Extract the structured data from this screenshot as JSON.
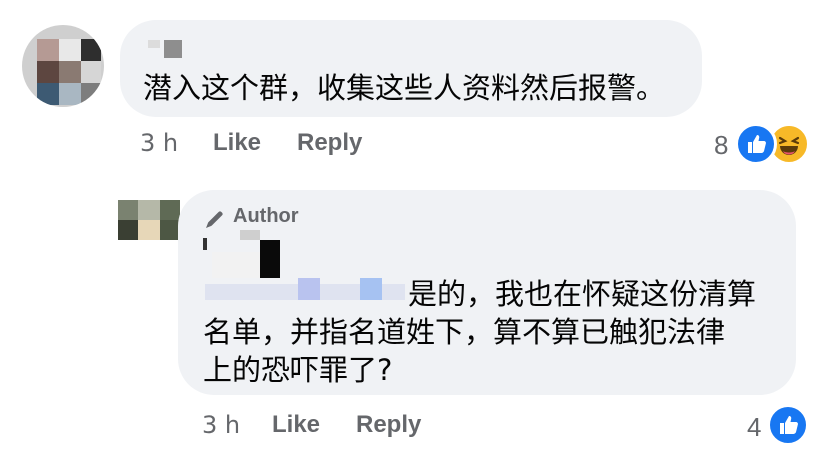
{
  "comment1": {
    "text": "潜入这个群，收集这些人资料然后报警。",
    "time": "3 h",
    "like_label": "Like",
    "reply_label": "Reply",
    "reaction_count": "8",
    "reactions": [
      "like-icon",
      "haha-icon"
    ]
  },
  "comment2": {
    "badge_label": "Author",
    "badge_icon": "pen-icon",
    "lines": [
      "是的，我也在怀疑这份清算",
      "名单，并指名道姓下，算不算已触犯法律",
      "上的恐吓罪了?"
    ],
    "time": "3 h",
    "like_label": "Like",
    "reply_label": "Reply",
    "reaction_count": "4",
    "reactions": [
      "like-icon"
    ]
  },
  "colors": {
    "bubble": "#f0f2f5",
    "meta_text": "#65676b",
    "like_blue": "#1877f2",
    "haha_yellow": "#f7b928"
  }
}
